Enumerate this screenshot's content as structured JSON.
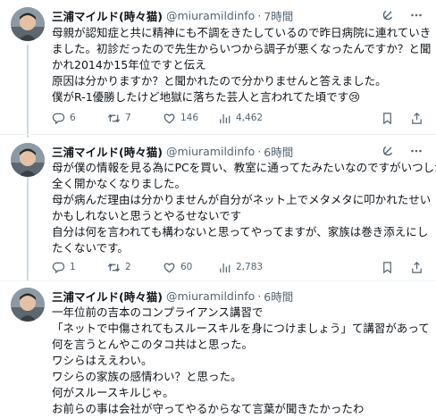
{
  "tweets": [
    {
      "name": "三浦マイルド(時々猫)",
      "handle": "@miuramildinfo",
      "dot": "·",
      "time": "7時間",
      "lines": [
        "母親が認知症と共に精神にも不調をきたしているので昨日病院に連れていき",
        "ました。初診だったので先生からいつから調子が悪くなったんですか？と聞",
        "かれ2014か15年位ですと伝え",
        "原因は分かりますか？と聞かれたので分かりませんと答えました。",
        "僕がR-1優勝したけど地獄に落ちた芸人と言われてた頃です😢"
      ],
      "stats": {
        "replies": "6",
        "retweets": "7",
        "likes": "146",
        "views": "4,462"
      }
    },
    {
      "name": "三浦マイルド(時々猫)",
      "handle": "@miuramildinfo",
      "dot": "·",
      "time": "6時間",
      "lines": [
        "母が僕の情報を見る為にPCを買い、教室に通ってたみたいなのですがいつしか",
        "全く開かなくなりました。",
        "母が病んだ理由は分かりませんが自分がネット上でメタメタに叩かれたせい",
        "かもしれないと思うとやるせないです",
        "自分は何を言われても構わないと思ってやってますが、家族は巻き添えにし",
        "たくないです。"
      ],
      "stats": {
        "replies": "1",
        "retweets": "2",
        "likes": "60",
        "views": "2,783"
      }
    },
    {
      "name": "三浦マイルド(時々猫)",
      "handle": "@miuramildinfo",
      "dot": "·",
      "time": "6時間",
      "lines": [
        "一年位前の吉本のコンプライアンス講習で",
        "「ネットで中傷されてもスルースキルを身につけましょう」て講習があって",
        "何を言うとんやこのタコ共はと思った。",
        "ワシらはええわい。",
        "ワシらの家族の感情わい？と思った。",
        "何がスルースキルじゃ。",
        "お前らの事は会社が守ってやるからなて言葉が聞きたかったわ"
      ]
    }
  ],
  "colors": {
    "text": "#0f1419",
    "muted": "#536471",
    "thread": "#cfd9de",
    "divider": "#eff3f4"
  }
}
